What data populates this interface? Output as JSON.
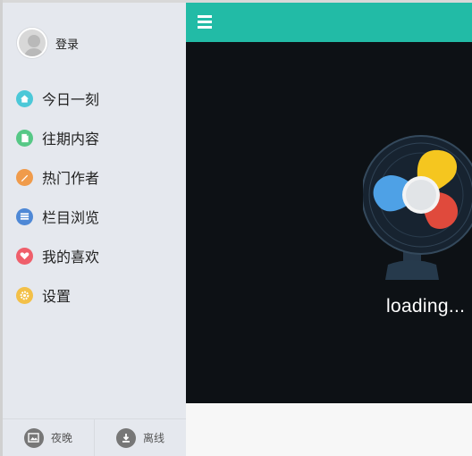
{
  "user": {
    "login_label": "登录"
  },
  "menu": [
    {
      "label": "今日一刻",
      "icon": "home-icon",
      "color": "#4cc8d8"
    },
    {
      "label": "往期内容",
      "icon": "document-icon",
      "color": "#56c886"
    },
    {
      "label": "热门作者",
      "icon": "pen-icon",
      "color": "#f09b4b"
    },
    {
      "label": "栏目浏览",
      "icon": "list-icon",
      "color": "#4e88d6"
    },
    {
      "label": "我的喜欢",
      "icon": "heart-icon",
      "color": "#ef5f6b"
    },
    {
      "label": "设置",
      "icon": "gear-icon",
      "color": "#f3c048"
    }
  ],
  "bottom": {
    "night_label": "夜晚",
    "offline_label": "离线"
  },
  "loader": {
    "text": "loading..."
  },
  "colors": {
    "header": "#22bba6",
    "sidebar": "#e5e8ee",
    "loader_bg": "#0d1115"
  }
}
